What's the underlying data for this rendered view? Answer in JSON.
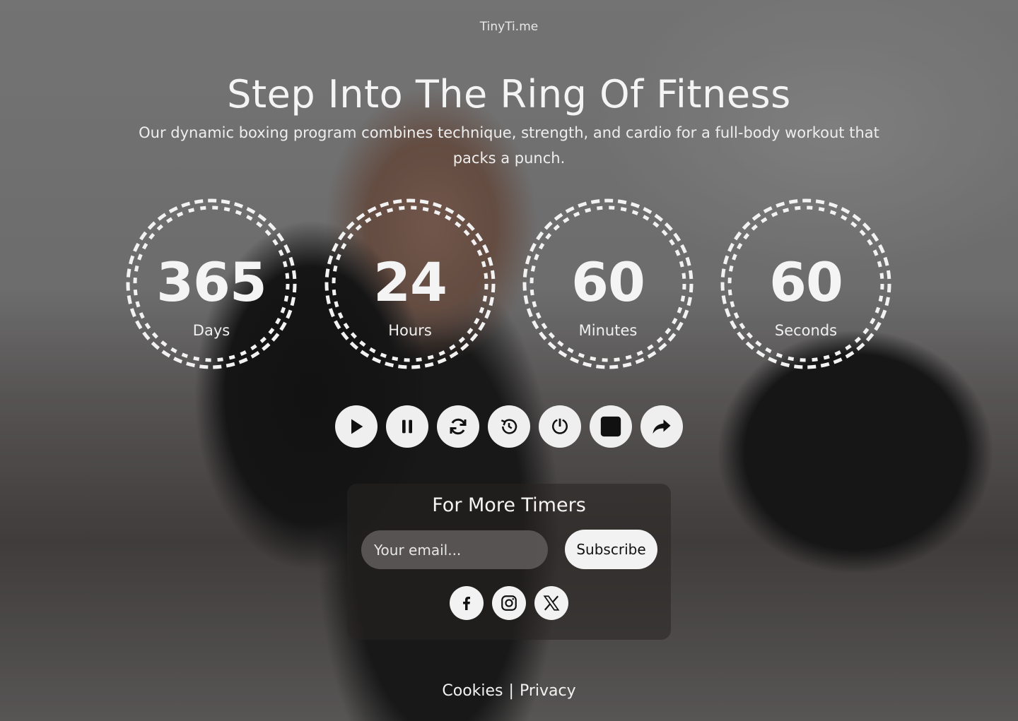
{
  "brand": "TinyTi.me",
  "hero": {
    "title": "Step Into The Ring Of Fitness",
    "subtitle": "Our dynamic boxing program combines technique, strength, and cardio for a full-body workout that packs a punch."
  },
  "countdown": [
    {
      "value": "365",
      "label": "Days"
    },
    {
      "value": "24",
      "label": "Hours"
    },
    {
      "value": "60",
      "label": "Minutes"
    },
    {
      "value": "60",
      "label": "Seconds"
    }
  ],
  "controls": [
    {
      "icon": "play-icon"
    },
    {
      "icon": "pause-icon"
    },
    {
      "icon": "refresh-icon"
    },
    {
      "icon": "history-icon"
    },
    {
      "icon": "timer-reset-icon"
    },
    {
      "icon": "stop-icon"
    },
    {
      "icon": "share-icon"
    }
  ],
  "subscribe": {
    "title": "For More Timers",
    "email_placeholder": "Your email...",
    "button_label": "Subscribe"
  },
  "social": [
    {
      "icon": "facebook-icon"
    },
    {
      "icon": "instagram-icon"
    },
    {
      "icon": "x-icon"
    }
  ],
  "footer": {
    "cookies": "Cookies",
    "separator": "|",
    "privacy": "Privacy"
  },
  "colors": {
    "dial_stroke": "#f2f2f2",
    "button_bg": "#efefef",
    "icon": "#111111"
  }
}
